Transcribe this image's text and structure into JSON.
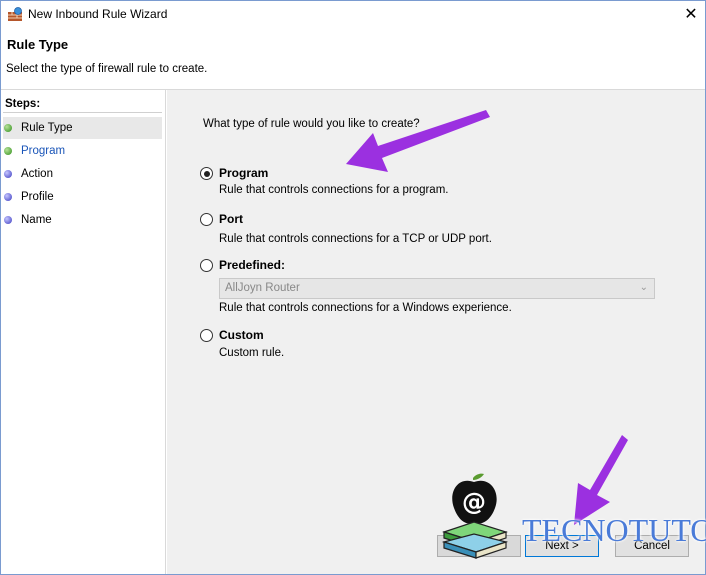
{
  "window": {
    "title": "New Inbound Rule Wizard",
    "close_glyph": "✕"
  },
  "header": {
    "title": "Rule Type",
    "description": "Select the type of firewall rule to create."
  },
  "steps": {
    "title": "Steps:",
    "items": [
      {
        "label": "Rule Type",
        "status": "done",
        "color": "#2f8f1a"
      },
      {
        "label": "Program",
        "status": "current",
        "color": "#2f8f1a"
      },
      {
        "label": "Action",
        "status": "pending",
        "color": "#3a3ac0"
      },
      {
        "label": "Profile",
        "status": "pending",
        "color": "#3a3ac0"
      },
      {
        "label": "Name",
        "status": "pending",
        "color": "#3a3ac0"
      }
    ]
  },
  "main": {
    "question": "What type of rule would you like to create?",
    "options": [
      {
        "label": "Program",
        "description": "Rule that controls connections for a program.",
        "checked": true
      },
      {
        "label": "Port",
        "description": "Rule that controls connections for a TCP or UDP port.",
        "checked": false
      },
      {
        "label": "Predefined:",
        "description": "Rule that controls connections for a Windows experience.",
        "checked": false
      },
      {
        "label": "Custom",
        "description": "Custom rule.",
        "checked": false
      }
    ],
    "predefined_select": {
      "value": "AllJoyn Router",
      "disabled": true
    }
  },
  "buttons": {
    "back": "< Back",
    "next": "Next >",
    "cancel": "Cancel"
  },
  "watermark": {
    "brand": "TECNOTUTO",
    "logo_symbol": "@"
  },
  "colors": {
    "accent": "#0078d7",
    "annotation_arrow": "#9b30e0",
    "brand": "#4a7bd8"
  }
}
